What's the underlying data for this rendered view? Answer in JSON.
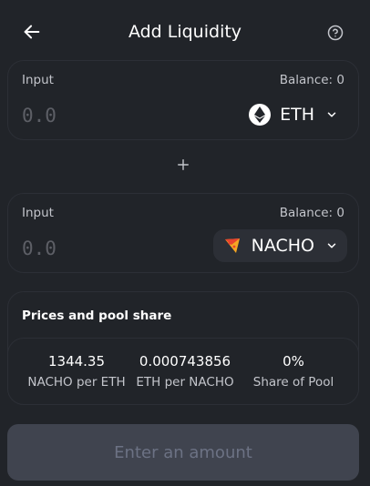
{
  "header": {
    "title": "Add Liquidity",
    "back_icon": "arrow-left-icon",
    "help_icon": "question-circle-icon"
  },
  "input_a": {
    "label": "Input",
    "balance": "Balance: 0",
    "placeholder": "0.0",
    "value": "",
    "token": "ETH",
    "token_icon": "eth-logo-icon"
  },
  "plus_icon": "plus-icon",
  "input_b": {
    "label": "Input",
    "balance": "Balance: 0",
    "placeholder": "0.0",
    "value": "",
    "token": "NACHO",
    "token_icon": "nacho-logo-icon"
  },
  "pool": {
    "title": "Prices and pool share",
    "stats": [
      {
        "value": "1344.35",
        "label": "NACHO per ETH"
      },
      {
        "value": "0.000743856",
        "label": "ETH per NACHO"
      },
      {
        "value": "0%",
        "label": "Share of Pool"
      }
    ]
  },
  "submit": {
    "label": "Enter an amount"
  },
  "colors": {
    "background": "#212429",
    "border": "#2c2f36",
    "muted_text": "#c3c5cb",
    "button_bg": "#40444f",
    "button_text": "#6c7284"
  }
}
